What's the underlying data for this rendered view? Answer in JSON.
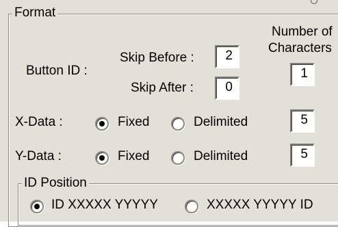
{
  "format": {
    "legend": "Format",
    "number_of_characters_line1": "Number of",
    "number_of_characters_line2": "Characters",
    "button_id": {
      "label": "Button ID :",
      "skip_before_label": "Skip Before :",
      "skip_before_value": "2",
      "skip_after_label": "Skip After :",
      "skip_after_value": "0",
      "chars_value": "1"
    },
    "x_data": {
      "label": "X-Data :",
      "fixed_label": "Fixed",
      "delimited_label": "Delimited",
      "fixed_selected": true,
      "delimited_selected": false,
      "chars_value": "5"
    },
    "y_data": {
      "label": "Y-Data :",
      "fixed_label": "Fixed",
      "delimited_label": "Delimited",
      "fixed_selected": true,
      "delimited_selected": false,
      "chars_value": "5"
    },
    "id_position": {
      "legend": "ID Position",
      "option1_label": "ID XXXXX YYYYY",
      "option2_label": "XXXXX YYYYY ID",
      "option1_selected": true,
      "option2_selected": false
    }
  },
  "colors": {
    "dialog_background": "#e3e0d8",
    "field_background": "#ffffff",
    "radio_dot": "#000000"
  }
}
